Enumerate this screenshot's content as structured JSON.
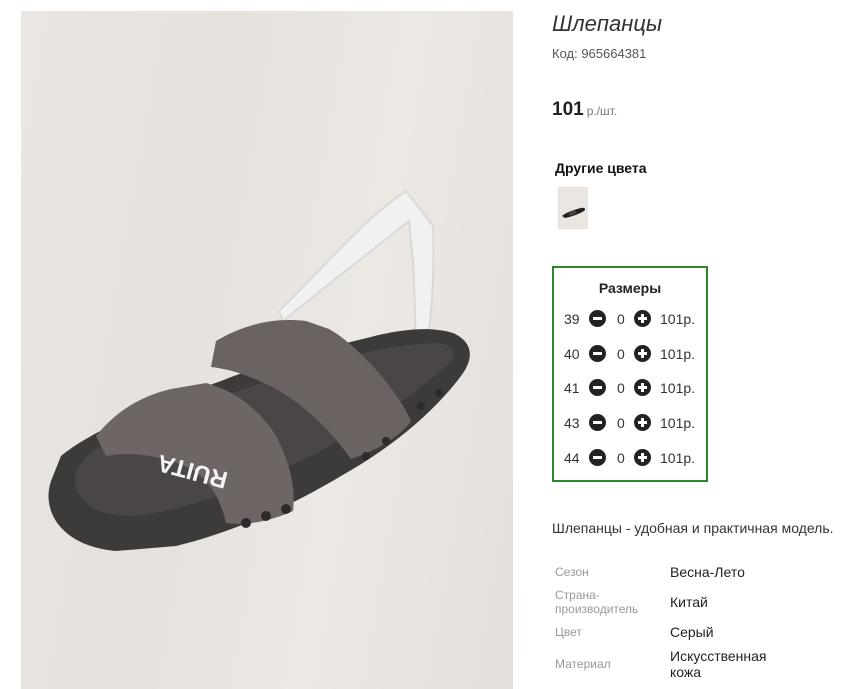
{
  "product": {
    "title": "Шлепанцы",
    "code_label": "Код: 965664381",
    "price_value": "101",
    "price_unit": "р./шт.",
    "image_alt": "Шлепанцы RUITA"
  },
  "other_colors": {
    "heading": "Другие цвета"
  },
  "sizes": {
    "heading": "Размеры",
    "rows": [
      {
        "size": "39",
        "qty": "0",
        "price": "101р."
      },
      {
        "size": "40",
        "qty": "0",
        "price": "101р."
      },
      {
        "size": "41",
        "qty": "0",
        "price": "101р."
      },
      {
        "size": "43",
        "qty": "0",
        "price": "101р."
      },
      {
        "size": "44",
        "qty": "0",
        "price": "101р."
      }
    ],
    "border_color": "#2a8a2a"
  },
  "description": "Шлепанцы - удобная и практичная модель.",
  "attributes": [
    {
      "label": "Сезон",
      "value": "Весна-Лето"
    },
    {
      "label": "Страна-\nпроизводитель",
      "value": "Китай"
    },
    {
      "label": "Цвет",
      "value": "Серый"
    },
    {
      "label": "Материал",
      "value": "Искусственная\nкожа"
    }
  ],
  "photo_logo_text": "RUITA",
  "icons": {
    "minus": "minus-circle-icon",
    "plus": "plus-circle-icon"
  }
}
